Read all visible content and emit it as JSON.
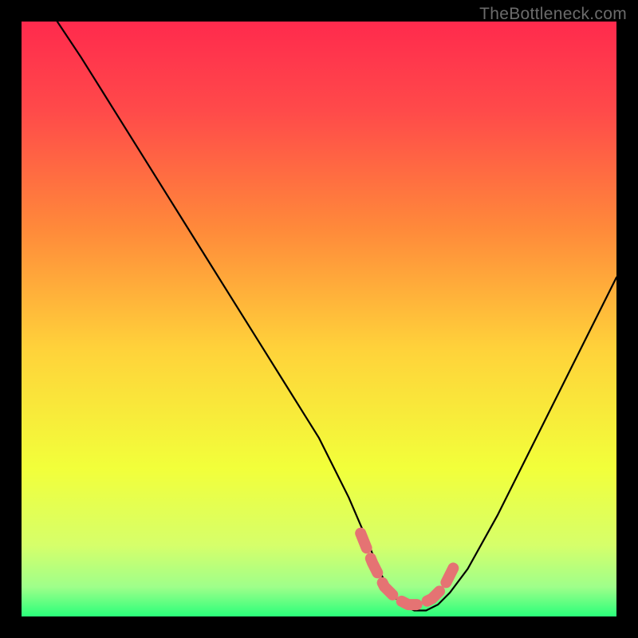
{
  "watermark": "TheBottleneck.com",
  "chart_data": {
    "type": "line",
    "title": "",
    "xlabel": "",
    "ylabel": "",
    "xlim": [
      0,
      100
    ],
    "ylim": [
      0,
      100
    ],
    "grid": false,
    "legend": false,
    "curve": {
      "x": [
        6,
        10,
        15,
        20,
        25,
        30,
        35,
        40,
        45,
        50,
        55,
        58,
        60,
        62,
        64,
        66,
        68,
        70,
        72,
        75,
        80,
        85,
        90,
        95,
        100
      ],
      "y_norm": [
        100,
        94,
        86,
        78,
        70,
        62,
        54,
        46,
        38,
        30,
        20,
        13,
        8,
        4,
        2,
        1,
        1,
        2,
        4,
        8,
        17,
        27,
        37,
        47,
        57
      ]
    },
    "highlight_segment": {
      "x": [
        57,
        59,
        61,
        63,
        65,
        67,
        69,
        71,
        73
      ],
      "y_norm": [
        14,
        9,
        5,
        3,
        2,
        2,
        3,
        5,
        9
      ],
      "color_hex": "#e57373"
    },
    "gradient_stops": [
      {
        "offset": 0.0,
        "color": "#ff2a4d"
      },
      {
        "offset": 0.15,
        "color": "#ff4a4a"
      },
      {
        "offset": 0.35,
        "color": "#ff8a3a"
      },
      {
        "offset": 0.55,
        "color": "#ffd23a"
      },
      {
        "offset": 0.75,
        "color": "#f2ff3a"
      },
      {
        "offset": 0.88,
        "color": "#d6ff6a"
      },
      {
        "offset": 0.95,
        "color": "#9fff8a"
      },
      {
        "offset": 1.0,
        "color": "#2aff7a"
      }
    ]
  }
}
